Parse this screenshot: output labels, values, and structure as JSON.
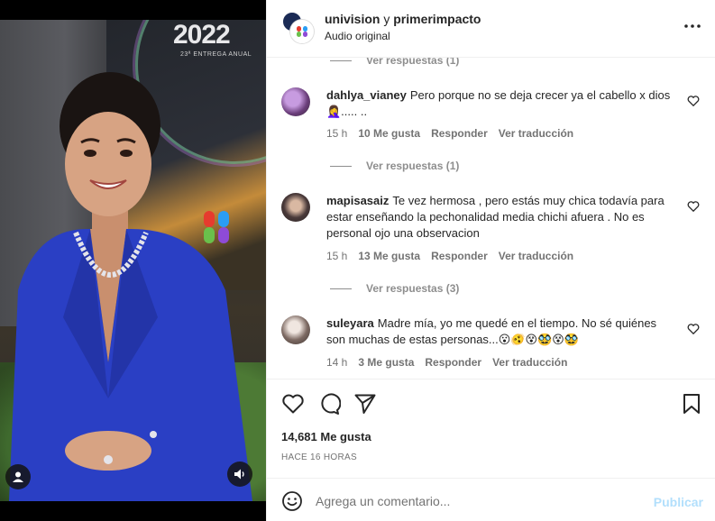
{
  "media": {
    "event_logo_text": "2022",
    "event_logo_sub": "23ª ENTREGA ANUAL",
    "user_tag_icon": "person-icon",
    "mute_icon": "speaker-icon"
  },
  "header": {
    "account_1": "univision",
    "connector": "y",
    "account_2": "primerimpacto",
    "audio_label": "Audio original",
    "more_icon": "more-horizontal-icon"
  },
  "comments": {
    "top_view_replies": "Ver respuestas (1)",
    "items": [
      {
        "username": "dahlya_vianey",
        "text": "Pero porque no se deja crecer ya el cabello x dios 🤦‍♀️..... ..",
        "time": "15 h",
        "likes": "10 Me gusta",
        "reply": "Responder",
        "translate": "Ver traducción",
        "view_replies": "Ver respuestas (1)"
      },
      {
        "username": "mapisasaiz",
        "text": "Te vez hermosa , pero estás muy chica todavía para estar enseñando la pechonalidad media chichi afuera . No es personal ojo una observacion",
        "time": "15 h",
        "likes": "13 Me gusta",
        "reply": "Responder",
        "translate": "Ver traducción",
        "view_replies": "Ver respuestas (3)"
      },
      {
        "username": "suleyara",
        "text": "Madre mía, yo me quedé en el tiempo. No sé quiénes son muchas de estas personas...😮🫨😵🥸😵🥸",
        "time": "14 h",
        "likes": "3 Me gusta",
        "reply": "Responder",
        "translate": "Ver traducción"
      }
    ]
  },
  "actions": {
    "like_icon": "heart-icon",
    "comment_icon": "comment-icon",
    "share_icon": "send-icon",
    "save_icon": "bookmark-icon",
    "likes_count": "14,681 Me gusta",
    "time_ago": "HACE 16 HORAS"
  },
  "add_comment": {
    "emoji_icon": "smiley-icon",
    "placeholder": "Agrega un comentario...",
    "post_label": "Publicar"
  },
  "colors": {
    "text": "#262626",
    "muted": "#737373",
    "border": "#efefef",
    "post_disabled": "#b2dffc",
    "dress_blue": "#2a3fc4"
  }
}
